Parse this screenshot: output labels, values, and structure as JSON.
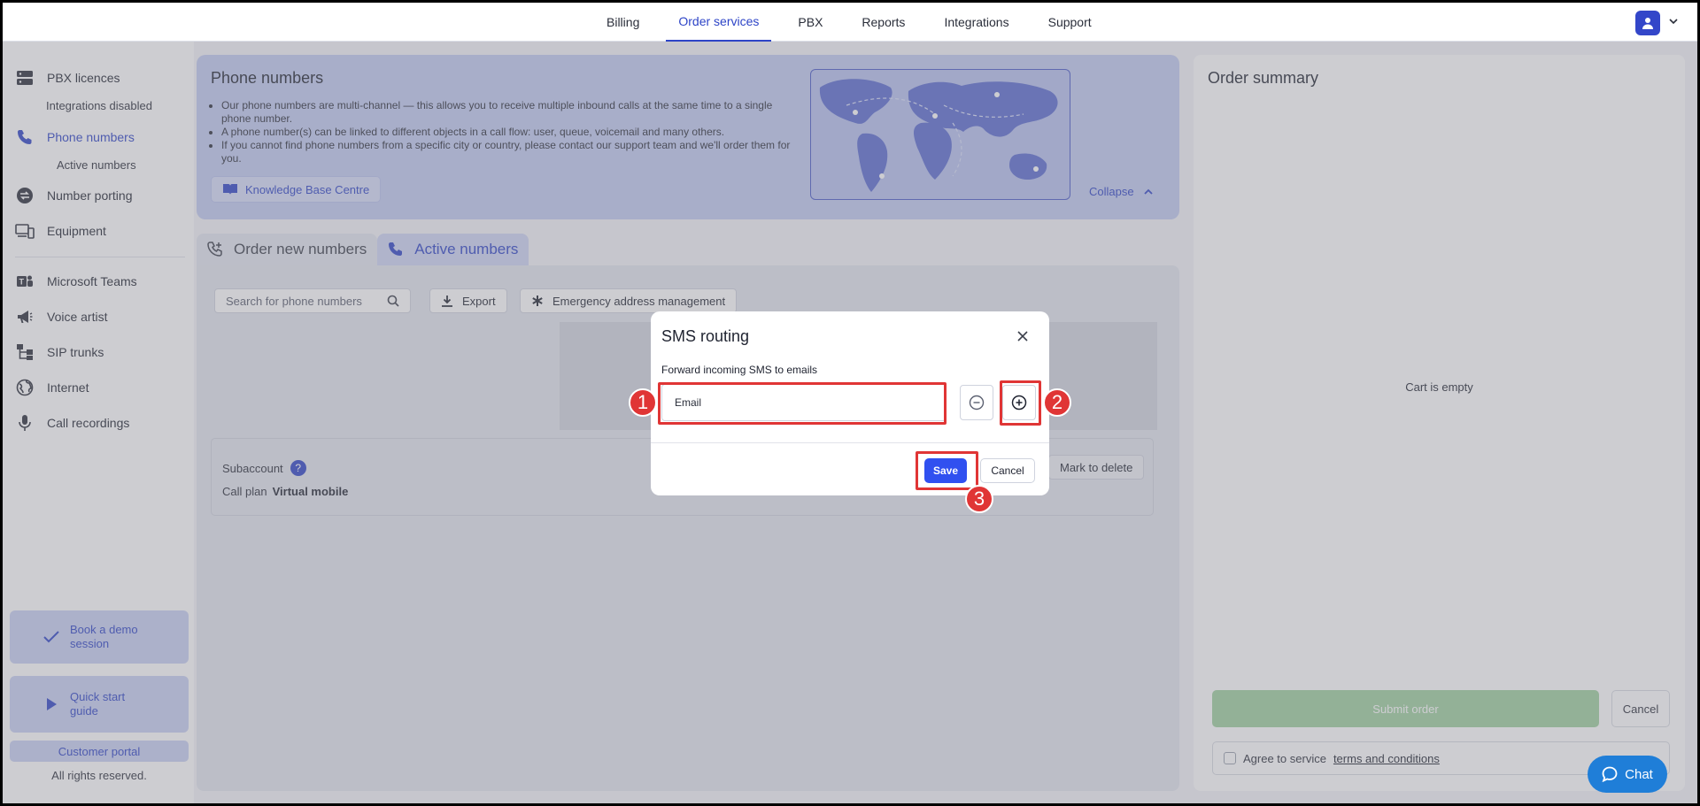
{
  "topnav": {
    "items": [
      "Billing",
      "Order services",
      "PBX",
      "Reports",
      "Integrations",
      "Support"
    ],
    "active_index": 1
  },
  "sidebar": {
    "pbx_licences": "PBX licences",
    "integrations_disabled": "Integrations disabled",
    "phone_numbers": "Phone numbers",
    "active_numbers": "Active numbers",
    "number_porting": "Number porting",
    "equipment": "Equipment",
    "microsoft_teams": "Microsoft Teams",
    "voice_artist": "Voice artist",
    "sip_trunks": "SIP trunks",
    "internet": "Internet",
    "call_recordings": "Call recordings",
    "book_demo": "Book a demo session",
    "quick_start": "Quick start guide",
    "customer_portal": "Customer portal",
    "rights": "All rights reserved."
  },
  "info": {
    "title": "Phone numbers",
    "bullets": [
      "Our phone numbers are multi-channel — this allows you to receive multiple inbound calls at the same time to a single phone number.",
      "A phone number(s) can be linked to different objects in a call flow: user, queue, voicemail and many others.",
      "If you cannot find phone numbers from a specific city or country, please contact our support team and we'll order them for you."
    ],
    "kb_button": "Knowledge Base Centre",
    "collapse": "Collapse"
  },
  "tabs": {
    "order_new": "Order new numbers",
    "active": "Active numbers"
  },
  "toolbar": {
    "search_placeholder": "Search for phone numbers",
    "export": "Export",
    "emergency": "Emergency address management"
  },
  "subaccount": {
    "label": "Subaccount",
    "help": "?",
    "call_plan_label": "Call plan",
    "call_plan_value": "Virtual mobile",
    "mark_delete": "Mark to delete"
  },
  "order": {
    "title": "Order summary",
    "cart_empty": "Cart is empty",
    "submit": "Submit order",
    "cancel": "Cancel",
    "agree_text": "Agree to service",
    "terms": "terms and conditions"
  },
  "modal": {
    "title": "SMS routing",
    "label": "Forward incoming SMS to emails",
    "email_placeholder": "Email",
    "save": "Save",
    "cancel": "Cancel"
  },
  "annotations": [
    "1",
    "2",
    "3"
  ],
  "chat": "Chat",
  "colors": {
    "accent": "#2d44c7",
    "save": "#3050f0",
    "highlight": "#e03535",
    "submit": "#9fd19f",
    "chat": "#1f7ed8"
  }
}
